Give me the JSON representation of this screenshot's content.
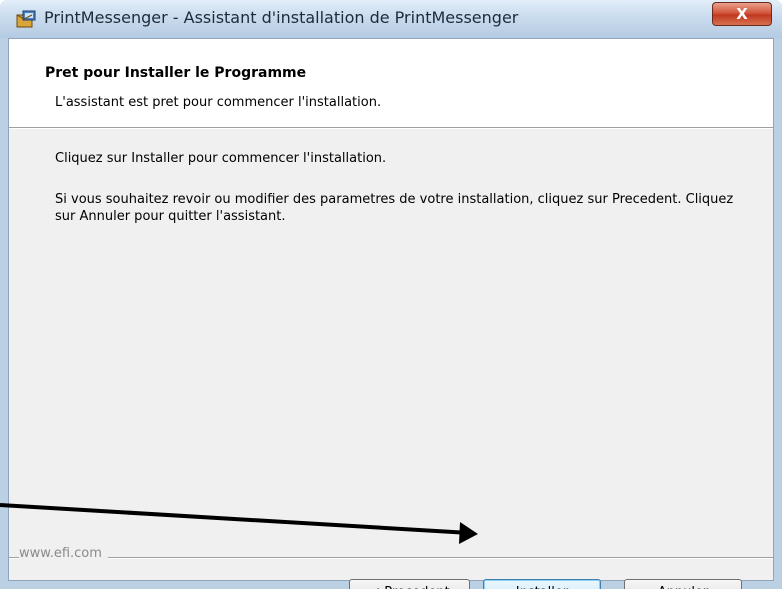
{
  "window": {
    "title": "PrintMessenger - Assistant d'installation de PrintMessenger",
    "close_label": "X"
  },
  "header": {
    "title": "Pret pour Installer le Programme",
    "subtitle": "L'assistant est pret pour commencer l'installation."
  },
  "body": {
    "instruction": "Cliquez sur Installer pour commencer l'installation.",
    "description": "Si vous souhaitez revoir ou modifier des parametres de votre installation, cliquez sur Precedent. Cliquez sur Annuler pour quitter l'assistant."
  },
  "footer": {
    "brand": "www.efi.com"
  },
  "buttons": {
    "back": "< Precedent",
    "install": "Installer",
    "cancel": "Annuler"
  },
  "icons": {
    "app": "installer-box-icon",
    "close": "close-icon",
    "annotation": "pointer-arrow"
  },
  "colors": {
    "close_button": "#d3563b",
    "default_button": "#bee6fd",
    "annotation_arrow": "#000000"
  }
}
